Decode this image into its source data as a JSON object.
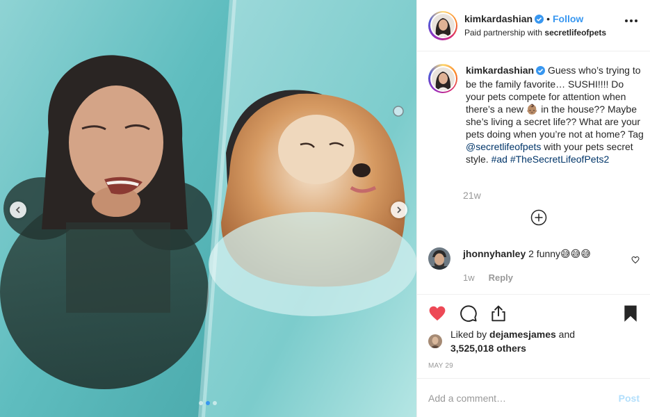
{
  "header": {
    "username": "kimkardashian",
    "separator": "•",
    "follow_label": "Follow",
    "partnership_prefix": "Paid partnership with",
    "partner_name": "secretlifeofpets"
  },
  "caption": {
    "username": "kimkardashian",
    "text_part1": "Guess who’s trying to be the family favorite… SUSHI!!!! Do your pets compete for attention when there’s a new",
    "emoji": "👶🏽",
    "text_part2": "in the house?? Maybe she’s living a secret life?? What are your pets doing when you’re not at home? Tag",
    "mention": "@secretlifeofpets",
    "text_part3": "with your pets secret style.",
    "hashtag1": "#ad",
    "hashtag2": "#TheSecretLifeofPets2",
    "age": "21w"
  },
  "comment": {
    "username": "jhonnyhanley",
    "text": "2 funny😅😅😅",
    "age": "1w",
    "reply_label": "Reply"
  },
  "likes": {
    "prefix": "Liked by",
    "username": "dejamesjames",
    "and": "and",
    "count": "3,525,018 others"
  },
  "date": "MAY 29",
  "add_comment": {
    "placeholder": "Add a comment…",
    "post_label": "Post"
  },
  "carousel": {
    "total": 3,
    "active_index": 1
  },
  "colors": {
    "accent": "#3897f0",
    "like_red": "#ed4956",
    "link_navy": "#003569",
    "muted": "#999999",
    "post_disabled": "#b2dffc"
  },
  "icons": {
    "prev": "chevron-left-icon",
    "next": "chevron-right-icon",
    "like": "heart-filled-icon",
    "comment": "comment-bubble-icon",
    "share": "share-icon",
    "save": "bookmark-filled-icon",
    "load_more": "plus-circle-icon",
    "more": "ellipsis-icon",
    "verified": "verified-badge-icon"
  }
}
